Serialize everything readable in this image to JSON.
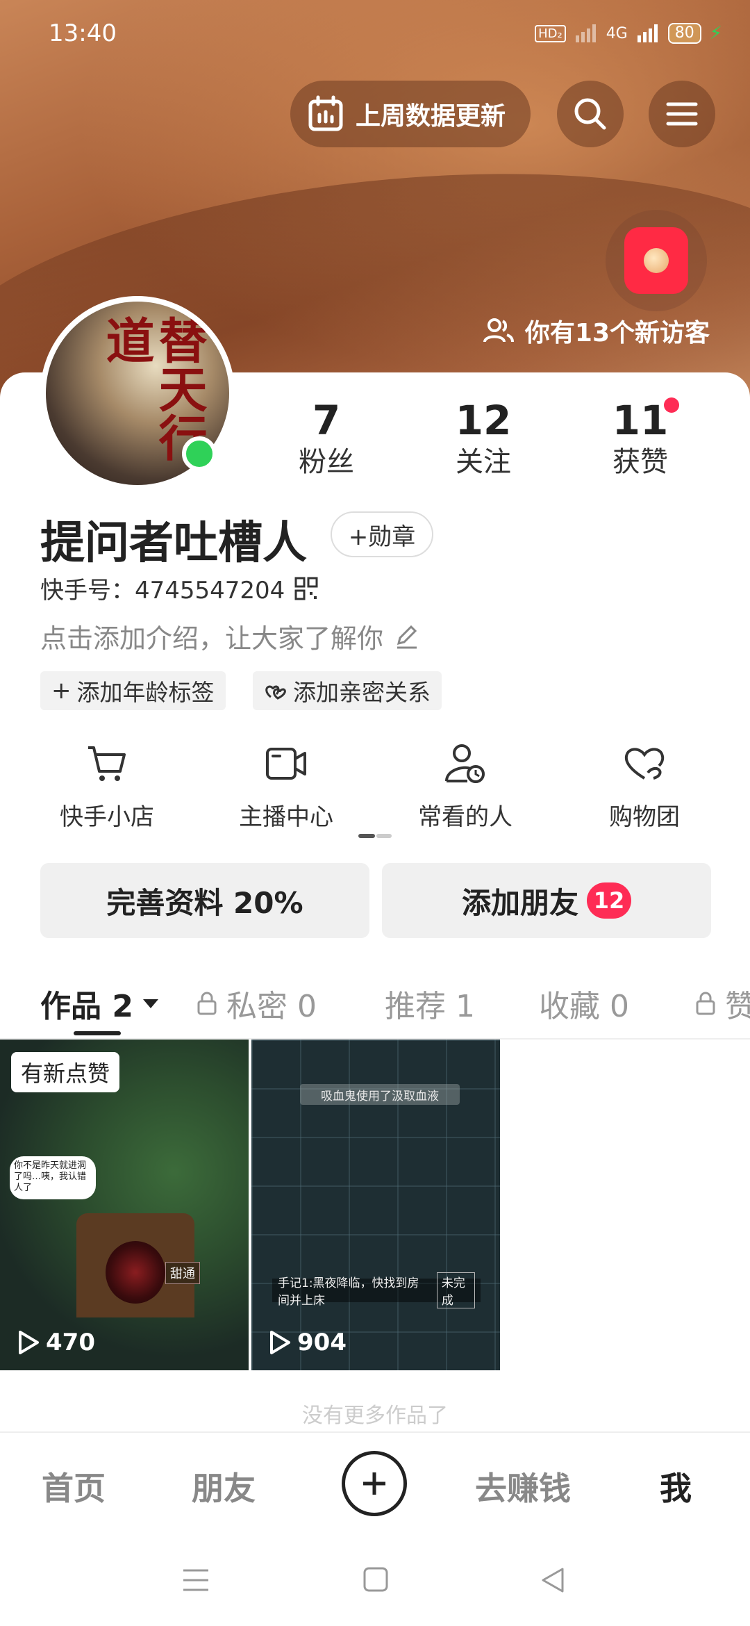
{
  "status_bar": {
    "time": "13:40",
    "network": "HD₂",
    "signal": "4G",
    "battery": "80"
  },
  "header": {
    "weekly_data_label": "上周数据更新",
    "visitors_text": "你有13个新访客"
  },
  "profile": {
    "avatar_title": "替天行道",
    "followers": {
      "value": "7",
      "label": "粉丝"
    },
    "following": {
      "value": "12",
      "label": "关注"
    },
    "likes": {
      "value": "11",
      "label": "获赞"
    },
    "name": "提问者吐槽人",
    "medal_label": "+勋章",
    "kuaishou_id": "快手号：4745547204",
    "bio_placeholder": "点击添加介绍，让大家了解你",
    "tags": [
      "添加年龄标签",
      "添加亲密关系"
    ]
  },
  "shortcuts": [
    {
      "label": "快手小店",
      "icon": "cart-icon"
    },
    {
      "label": "主播中心",
      "icon": "video-camera-icon"
    },
    {
      "label": "常看的人",
      "icon": "person-clock-icon"
    },
    {
      "label": "购物团",
      "icon": "heart-hands-icon"
    }
  ],
  "actions": {
    "complete_profile": "完善资料 20%",
    "add_friends": "添加朋友",
    "add_friends_badge": "12"
  },
  "tabs": [
    {
      "label": "作品 2",
      "active": true
    },
    {
      "label": "私密 0",
      "locked": true
    },
    {
      "label": "推荐 1"
    },
    {
      "label": "收藏 0"
    },
    {
      "label": "赞",
      "locked": true
    }
  ],
  "works": [
    {
      "badge": "有新点赞",
      "plays": "470",
      "bubble_text": "你不是昨天就进洞了吗…咦，我认错人了",
      "sign_text": "甜通"
    },
    {
      "plays": "904",
      "banner_text": "吸血鬼使用了汲取血液",
      "tip_text": "手记1:黑夜降临，快找到房间并上床",
      "tip_status": "未完成"
    }
  ],
  "faded_footer": "没有更多作品了",
  "bottom_nav": {
    "home": "首页",
    "friends": "朋友",
    "earn": "去赚钱",
    "me": "我"
  },
  "colors": {
    "accent_red": "#fe2c55",
    "online_green": "#2fd158"
  }
}
